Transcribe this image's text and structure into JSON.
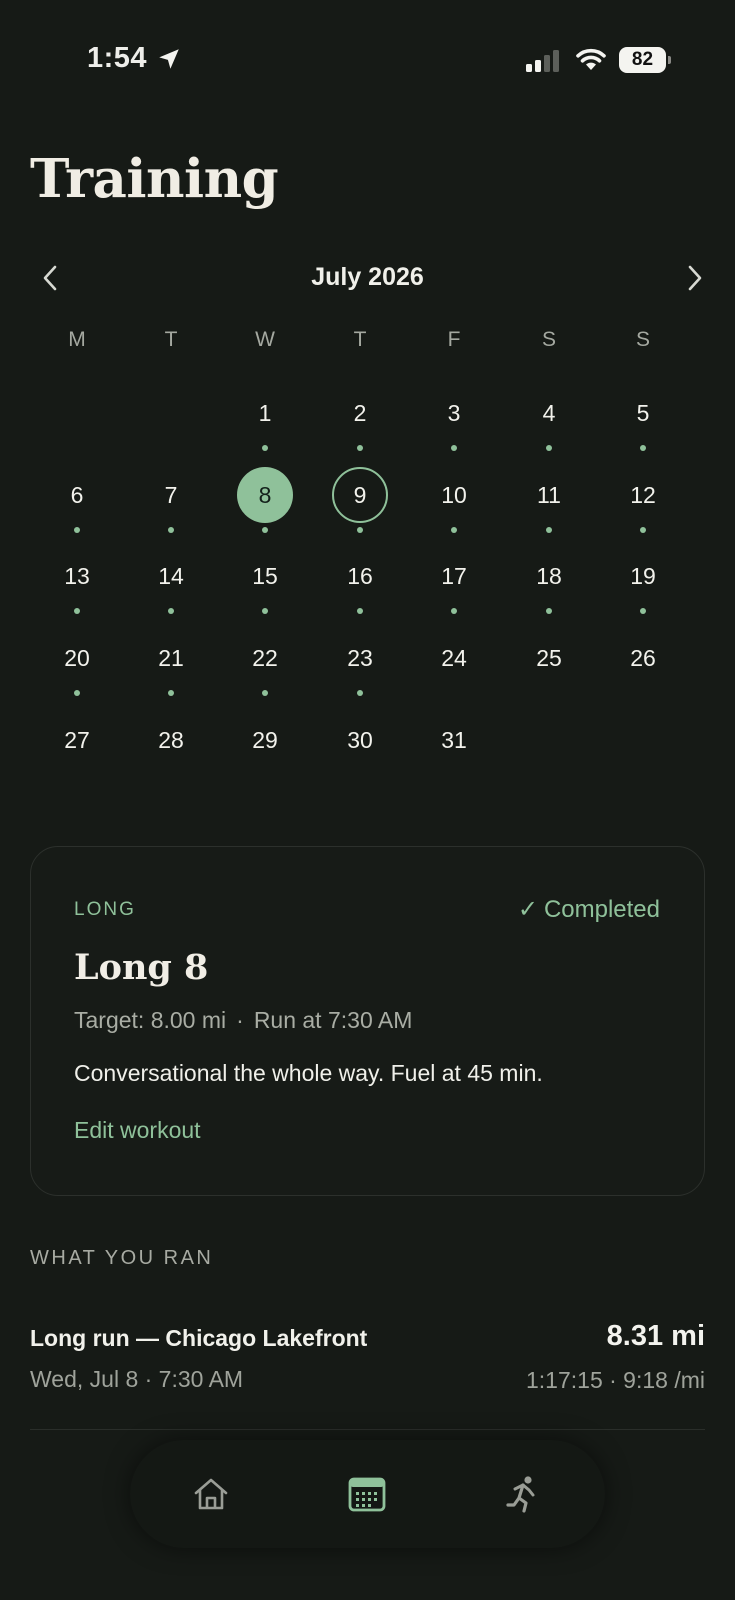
{
  "status_bar": {
    "time": "1:54",
    "battery": "82"
  },
  "page": {
    "title": "Training"
  },
  "calendar": {
    "month_label": "July 2026",
    "weekdays": [
      "M",
      "T",
      "W",
      "T",
      "F",
      "S",
      "S"
    ],
    "days": [
      {
        "num": "1",
        "dot": true
      },
      {
        "num": "2",
        "dot": true
      },
      {
        "num": "3",
        "dot": true
      },
      {
        "num": "4",
        "dot": true
      },
      {
        "num": "5",
        "dot": true
      },
      {
        "num": "6",
        "dot": true
      },
      {
        "num": "7",
        "dot": true
      },
      {
        "num": "8",
        "dot": true,
        "state": "selected"
      },
      {
        "num": "9",
        "dot": true,
        "state": "today"
      },
      {
        "num": "10",
        "dot": true
      },
      {
        "num": "11",
        "dot": true
      },
      {
        "num": "12",
        "dot": true
      },
      {
        "num": "13",
        "dot": true
      },
      {
        "num": "14",
        "dot": true
      },
      {
        "num": "15",
        "dot": true
      },
      {
        "num": "16",
        "dot": true
      },
      {
        "num": "17",
        "dot": true
      },
      {
        "num": "18",
        "dot": true
      },
      {
        "num": "19",
        "dot": true
      },
      {
        "num": "20",
        "dot": true
      },
      {
        "num": "21",
        "dot": true
      },
      {
        "num": "22",
        "dot": true
      },
      {
        "num": "23",
        "dot": true
      },
      {
        "num": "24",
        "dot": false
      },
      {
        "num": "25",
        "dot": false
      },
      {
        "num": "26",
        "dot": false
      },
      {
        "num": "27",
        "dot": false
      },
      {
        "num": "28",
        "dot": false
      },
      {
        "num": "29",
        "dot": false
      },
      {
        "num": "30",
        "dot": false
      },
      {
        "num": "31",
        "dot": false
      }
    ]
  },
  "workout": {
    "tag": "LONG",
    "status": "Completed",
    "status_icon": "check-icon",
    "title": "Long 8",
    "target": "Target: 8.00 mi",
    "separator": "·",
    "run_time": "Run at 7:30 AM",
    "notes": "Conversational the whole way. Fuel at 45 min.",
    "edit_label": "Edit workout"
  },
  "what_you_ran": {
    "label": "WHAT YOU RAN",
    "runs": [
      {
        "title": "Long run — Chicago Lakefront",
        "date": "Wed, Jul 8 · 7:30 AM",
        "distance": "8.31 mi",
        "stats": "1:17:15 · 9:18 /mi"
      }
    ]
  },
  "tab_bar": {
    "tabs": [
      {
        "name": "home",
        "icon": "home-icon"
      },
      {
        "name": "calendar",
        "icon": "calendar-icon",
        "active": true
      },
      {
        "name": "runs",
        "icon": "runner-icon"
      }
    ]
  },
  "colors": {
    "background": "#161a16",
    "accent": "#8fc19a",
    "muted_text": "#a7aaa2"
  }
}
